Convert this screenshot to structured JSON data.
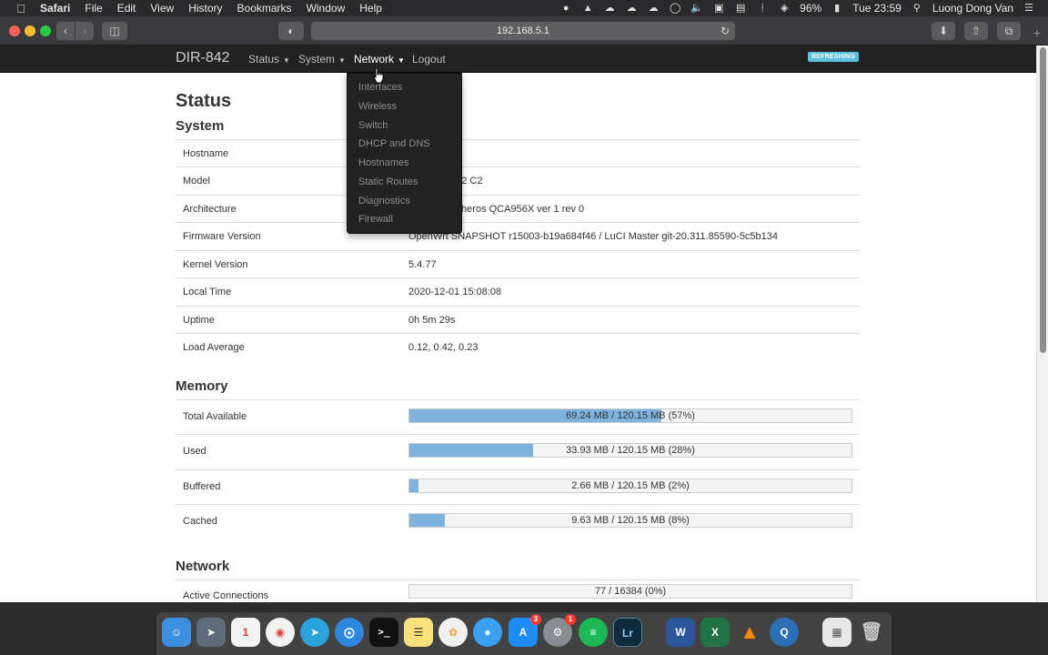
{
  "menubar": {
    "app_name": "Safari",
    "menus": [
      "File",
      "Edit",
      "View",
      "History",
      "Bookmarks",
      "Window",
      "Help"
    ],
    "battery": "96%",
    "clock": "Tue 23:59",
    "user": "Luong Dong Van"
  },
  "browser": {
    "url": "192.168.5.1"
  },
  "luci": {
    "brand": "DIR-842",
    "nav": {
      "status": "Status",
      "system": "System",
      "network": "Network",
      "logout": "Logout"
    },
    "refresh_badge": "REFRESHING",
    "network_menu": [
      "Interfaces",
      "Wireless",
      "Switch",
      "DHCP and DNS",
      "Hostnames",
      "Static Routes",
      "Diagnostics",
      "Firewall"
    ]
  },
  "page": {
    "title": "Status",
    "system": {
      "heading": "System",
      "rows": [
        {
          "label": "Hostname",
          "value": ""
        },
        {
          "label": "Model",
          "value": "842 C2"
        },
        {
          "label": "Architecture",
          "value": "theros QCA956X ver 1 rev 0"
        },
        {
          "label": "Firmware Version",
          "value": "OpenWrt SNAPSHOT r15003-b19a684f46 / LuCI Master git-20.311.85590-5c5b134"
        },
        {
          "label": "Kernel Version",
          "value": "5.4.77"
        },
        {
          "label": "Local Time",
          "value": "2020-12-01 15:08:08"
        },
        {
          "label": "Uptime",
          "value": "0h 5m 29s"
        },
        {
          "label": "Load Average",
          "value": "0.12, 0.42, 0.23"
        }
      ]
    },
    "memory": {
      "heading": "Memory",
      "rows": [
        {
          "label": "Total Available",
          "text": "69.24 MB / 120.15 MB (57%)",
          "percent": 57
        },
        {
          "label": "Used",
          "text": "33.93 MB / 120.15 MB (28%)",
          "percent": 28
        },
        {
          "label": "Buffered",
          "text": "2.66 MB / 120.15 MB (2%)",
          "percent": 2
        },
        {
          "label": "Cached",
          "text": "9.63 MB / 120.15 MB (8%)",
          "percent": 8
        }
      ]
    },
    "network": {
      "heading": "Network",
      "rows": [
        {
          "label": "Active Connections",
          "text": "77 / 16384 (0%)",
          "percent": 0
        }
      ]
    }
  },
  "colors": {
    "progress_fill": "#7fb2dc",
    "refresh_badge": "#5bc0de",
    "navbar": "#222222"
  }
}
